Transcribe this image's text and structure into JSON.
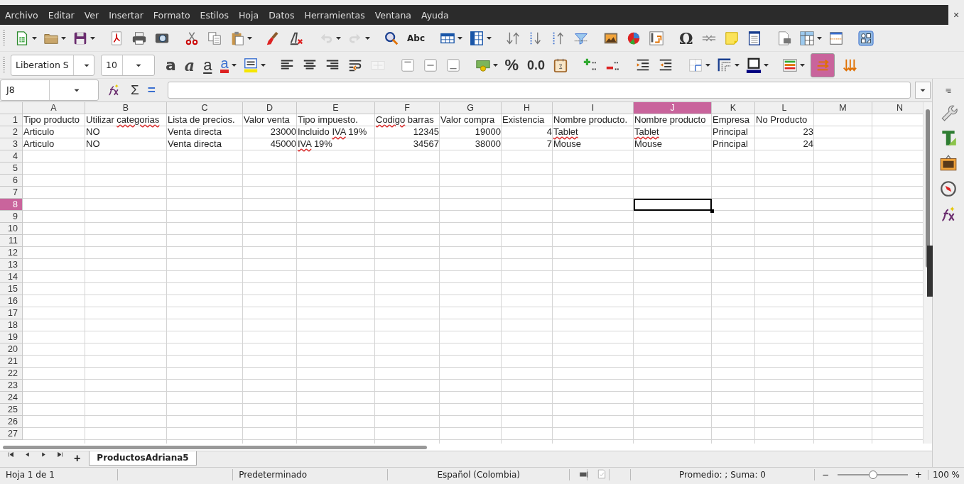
{
  "window": {
    "close": "×"
  },
  "menu": [
    "Archivo",
    "Editar",
    "Ver",
    "Insertar",
    "Formato",
    "Estilos",
    "Hoja",
    "Datos",
    "Herramientas",
    "Ventana",
    "Ayuda"
  ],
  "standard_toolbar": {
    "undo": {
      "disabled": true
    },
    "redo": {
      "disabled": true
    },
    "spelling": {
      "text": "Abc"
    },
    "special_character": {
      "text": "Ω"
    }
  },
  "formatting_toolbar": {
    "font_name": {
      "value": "Liberation S"
    },
    "font_size": {
      "value": "10"
    },
    "bold": {
      "text": "a"
    },
    "italic": {
      "text": "a"
    },
    "underline": {
      "text": "a"
    },
    "font_color": {
      "text": "a"
    },
    "merge_cells": {
      "disabled": true
    },
    "percent": {
      "text": "%"
    },
    "number_format": {
      "text": "0.0"
    },
    "wrap_toggle": {
      "on": true
    }
  },
  "formula_bar": {
    "name_box": "J8",
    "sum": "Σ",
    "equals": "="
  },
  "columns": [
    {
      "label": "A",
      "selected": false
    },
    {
      "label": "B",
      "selected": false
    },
    {
      "label": "C",
      "selected": false
    },
    {
      "label": "D",
      "selected": false
    },
    {
      "label": "E",
      "selected": false
    },
    {
      "label": "F",
      "selected": false
    },
    {
      "label": "G",
      "selected": false
    },
    {
      "label": "H",
      "selected": false
    },
    {
      "label": "I",
      "selected": false
    },
    {
      "label": "J",
      "selected": true
    },
    {
      "label": "K",
      "selected": false
    },
    {
      "label": "L",
      "selected": false
    },
    {
      "label": "M",
      "selected": false
    },
    {
      "label": "N",
      "selected": false
    }
  ],
  "rows": [
    {
      "number": "1",
      "selected": false,
      "cells": [
        {
          "kind": "text",
          "text": "Tipo producto"
        },
        {
          "kind": "text",
          "parts": [
            {
              "text": "Utilizar ",
              "misspelled": false
            },
            {
              "text": "categorias",
              "misspelled": true
            }
          ]
        },
        {
          "kind": "text",
          "text": "Lista de precios."
        },
        {
          "kind": "text",
          "text": "Valor venta"
        },
        {
          "kind": "text",
          "text": "Tipo impuesto."
        },
        {
          "kind": "text",
          "parts": [
            {
              "text": "Codigo",
              "misspelled": true
            },
            {
              "text": " barras",
              "misspelled": false
            }
          ]
        },
        {
          "kind": "text",
          "text": "Valor compra"
        },
        {
          "kind": "text",
          "text": "Existencia"
        },
        {
          "kind": "text",
          "text": "Nombre producto."
        },
        {
          "kind": "text",
          "text": "Nombre producto"
        },
        {
          "kind": "text",
          "text": "Empresa"
        },
        {
          "kind": "text",
          "text": "No Producto"
        }
      ]
    },
    {
      "number": "2",
      "selected": false,
      "cells": [
        {
          "kind": "text",
          "text": "Articulo"
        },
        {
          "kind": "text",
          "text": "NO"
        },
        {
          "kind": "text",
          "text": "Venta directa"
        },
        {
          "kind": "number",
          "text": "23000"
        },
        {
          "kind": "text",
          "parts": [
            {
              "text": "Incluido ",
              "misspelled": false
            },
            {
              "text": "IVA",
              "misspelled": true
            },
            {
              "text": " 19%",
              "misspelled": false
            }
          ]
        },
        {
          "kind": "number",
          "text": "12345"
        },
        {
          "kind": "number",
          "text": "19000"
        },
        {
          "kind": "number",
          "text": "4"
        },
        {
          "kind": "text",
          "parts": [
            {
              "text": "Tablet",
              "misspelled": true
            }
          ]
        },
        {
          "kind": "text",
          "parts": [
            {
              "text": "Tablet",
              "misspelled": true
            }
          ]
        },
        {
          "kind": "text",
          "text": "Principal"
        },
        {
          "kind": "number",
          "text": "23"
        }
      ]
    },
    {
      "number": "3",
      "selected": false,
      "cells": [
        {
          "kind": "text",
          "text": "Articulo"
        },
        {
          "kind": "text",
          "text": "NO"
        },
        {
          "kind": "text",
          "text": "Venta directa"
        },
        {
          "kind": "number",
          "text": "45000"
        },
        {
          "kind": "text",
          "parts": [
            {
              "text": "IVA",
              "misspelled": true
            },
            {
              "text": " 19%",
              "misspelled": false
            }
          ]
        },
        {
          "kind": "number",
          "text": "34567"
        },
        {
          "kind": "number",
          "text": "38000"
        },
        {
          "kind": "number",
          "text": "7"
        },
        {
          "kind": "text",
          "text": "Mouse"
        },
        {
          "kind": "text",
          "text": "Mouse"
        },
        {
          "kind": "text",
          "text": "Principal"
        },
        {
          "kind": "number",
          "text": "24"
        }
      ]
    },
    {
      "number": "4",
      "selected": false
    },
    {
      "number": "5",
      "selected": false
    },
    {
      "number": "6",
      "selected": false
    },
    {
      "number": "7",
      "selected": false
    },
    {
      "number": "8",
      "selected": true
    },
    {
      "number": "9",
      "selected": false
    },
    {
      "number": "10",
      "selected": false
    },
    {
      "number": "11",
      "selected": false
    },
    {
      "number": "12",
      "selected": false
    },
    {
      "number": "13",
      "selected": false
    },
    {
      "number": "14",
      "selected": false
    },
    {
      "number": "15",
      "selected": false
    },
    {
      "number": "16",
      "selected": false
    },
    {
      "number": "17",
      "selected": false
    },
    {
      "number": "18",
      "selected": false
    },
    {
      "number": "19",
      "selected": false
    },
    {
      "number": "20",
      "selected": false
    },
    {
      "number": "21",
      "selected": false
    },
    {
      "number": "22",
      "selected": false
    },
    {
      "number": "23",
      "selected": false
    },
    {
      "number": "24",
      "selected": false
    },
    {
      "number": "25",
      "selected": false
    },
    {
      "number": "26",
      "selected": false
    },
    {
      "number": "27",
      "selected": false
    }
  ],
  "sheet_tabs": {
    "add": "+",
    "tabs": [
      {
        "label": "ProductosAdriana5",
        "selected": true
      }
    ]
  },
  "status_bar": {
    "sheet": "Hoja 1 de 1",
    "page_style": "Predeterminado",
    "language": "Español (Colombia)",
    "summary": "Promedio: ; Suma: 0",
    "zoom_out": "−",
    "zoom_in": "+",
    "zoom": {
      "level": 0.5
    },
    "zoom_value": "100 %"
  }
}
